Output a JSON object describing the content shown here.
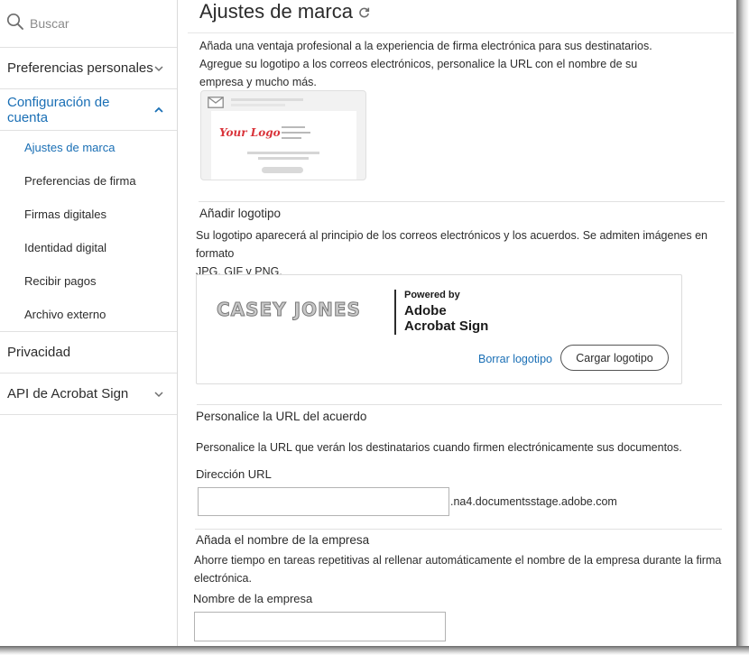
{
  "search": {
    "placeholder": "Buscar"
  },
  "sidebar": {
    "items": [
      {
        "label": "Preferencias personales",
        "expanded": false
      },
      {
        "label": "Configuración de cuenta",
        "expanded": true,
        "children": [
          "Ajustes de marca",
          "Preferencias de firma",
          "Firmas digitales",
          "Identidad digital",
          "Recibir pagos",
          "Archivo externo"
        ],
        "selected": "Ajustes de marca"
      },
      {
        "label": "Privacidad",
        "expanded": false
      },
      {
        "label": "API de Acrobat Sign",
        "expanded": false
      }
    ]
  },
  "page": {
    "title": "Ajustes de marca",
    "intro_line1": "Añada una ventaja profesional a la experiencia de firma electrónica para sus destinatarios.",
    "intro_line2": "Agregue su logotipo a los correos electrónicos, personalice la URL con el nombre de su",
    "intro_line3": "empresa y mucho más.",
    "preview_logo_text": "Your Logo"
  },
  "logo_section": {
    "heading": "Añadir logotipo",
    "desc_line1": "Su logotipo aparecerá al principio de los correos electrónicos y los acuerdos. Se admiten imágenes en formato",
    "desc_line2": "JPG, GIF y PNG.",
    "uploaded_logo_text": "CASEY JONES",
    "powered_by": "Powered by",
    "brand_line1": "Adobe",
    "brand_line2": "Acrobat Sign",
    "delete_label": "Borrar logotipo",
    "upload_label": "Cargar logotipo"
  },
  "url_section": {
    "heading": "Personalice la URL del acuerdo",
    "desc": "Personalice la URL que verán los destinatarios cuando firmen electrónicamente sus documentos.",
    "field_label": "Dirección URL",
    "value": "",
    "suffix": ".na4.documentsstage.adobe.com"
  },
  "company_section": {
    "heading": "Añada el nombre de la empresa",
    "desc_line1": "Ahorre tiempo en tareas repetitivas al rellenar automáticamente el nombre de la empresa durante la firma",
    "desc_line2": "electrónica.",
    "field_label": "Nombre de la empresa",
    "value": ""
  },
  "colors": {
    "accent": "#1a6fb5",
    "text": "#2c2c2c",
    "logo_red": "#d9343b"
  }
}
